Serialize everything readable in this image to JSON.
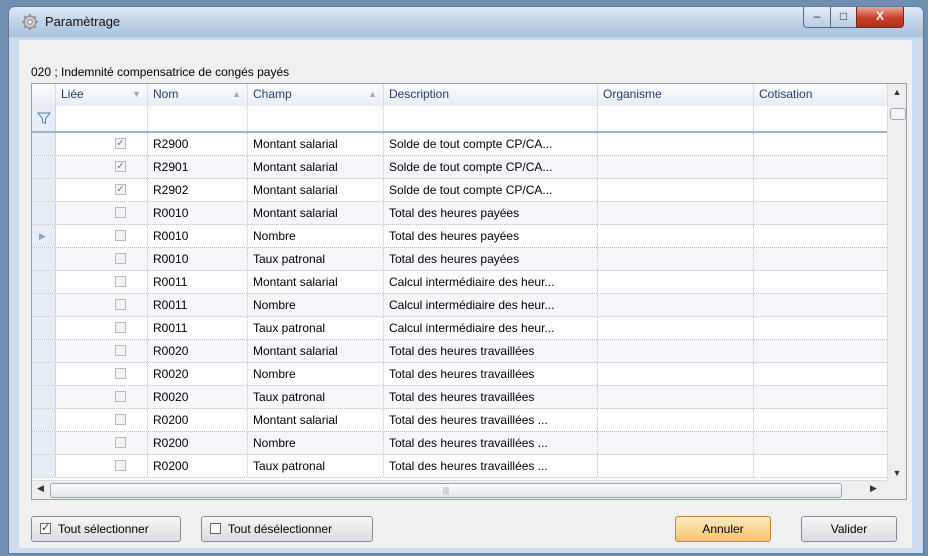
{
  "window": {
    "title": "Paramètrage"
  },
  "caption_buttons": {
    "minimize": "–",
    "maximize": "□",
    "close": "X"
  },
  "group": {
    "caption": "020 ; Indemnité compensatrice de congés payés"
  },
  "grid": {
    "columns": [
      "Liée",
      "Nom",
      "Champ",
      "Description",
      "Organisme",
      "Cotisation"
    ],
    "rows": [
      {
        "checked": true,
        "nom": "R2900",
        "champ": "Montant salarial",
        "description": "Solde de tout compte CP/CA...",
        "organisme": "",
        "cotisation": ""
      },
      {
        "checked": true,
        "nom": "R2901",
        "champ": "Montant salarial",
        "description": "Solde de tout compte CP/CA...",
        "organisme": "",
        "cotisation": ""
      },
      {
        "checked": true,
        "nom": "R2902",
        "champ": "Montant salarial",
        "description": "Solde de tout compte CP/CA...",
        "organisme": "",
        "cotisation": ""
      },
      {
        "checked": false,
        "nom": "R0010",
        "champ": "Montant salarial",
        "description": "Total des heures payées",
        "organisme": "",
        "cotisation": ""
      },
      {
        "checked": false,
        "nom": "R0010",
        "champ": "Nombre",
        "description": "Total des heures payées",
        "organisme": "",
        "cotisation": "",
        "current": true
      },
      {
        "checked": false,
        "nom": "R0010",
        "champ": "Taux patronal",
        "description": "Total des heures payées",
        "organisme": "",
        "cotisation": ""
      },
      {
        "checked": false,
        "nom": "R0011",
        "champ": "Montant salarial",
        "description": "Calcul intermédiaire des heur...",
        "organisme": "",
        "cotisation": ""
      },
      {
        "checked": false,
        "nom": "R0011",
        "champ": "Nombre",
        "description": "Calcul intermédiaire des heur...",
        "organisme": "",
        "cotisation": ""
      },
      {
        "checked": false,
        "nom": "R0011",
        "champ": "Taux patronal",
        "description": "Calcul intermédiaire des heur...",
        "organisme": "",
        "cotisation": ""
      },
      {
        "checked": false,
        "nom": "R0020",
        "champ": "Montant salarial",
        "description": "Total des heures travaillées",
        "organisme": "",
        "cotisation": ""
      },
      {
        "checked": false,
        "nom": "R0020",
        "champ": "Nombre",
        "description": "Total des heures travaillées",
        "organisme": "",
        "cotisation": ""
      },
      {
        "checked": false,
        "nom": "R0020",
        "champ": "Taux patronal",
        "description": "Total des heures travaillées",
        "organisme": "",
        "cotisation": ""
      },
      {
        "checked": false,
        "nom": "R0200",
        "champ": "Montant salarial",
        "description": "Total des heures travaillées ...",
        "organisme": "",
        "cotisation": ""
      },
      {
        "checked": false,
        "nom": "R0200",
        "champ": "Nombre",
        "description": "Total des heures travaillées ...",
        "organisme": "",
        "cotisation": ""
      },
      {
        "checked": false,
        "nom": "R0200",
        "champ": "Taux patronal",
        "description": "Total des heures travaillées ...",
        "organisme": "",
        "cotisation": ""
      }
    ]
  },
  "buttons": {
    "select_all": "Tout sélectionner",
    "deselect_all": "Tout désélectionner",
    "cancel": "Annuler",
    "ok": "Valider"
  }
}
